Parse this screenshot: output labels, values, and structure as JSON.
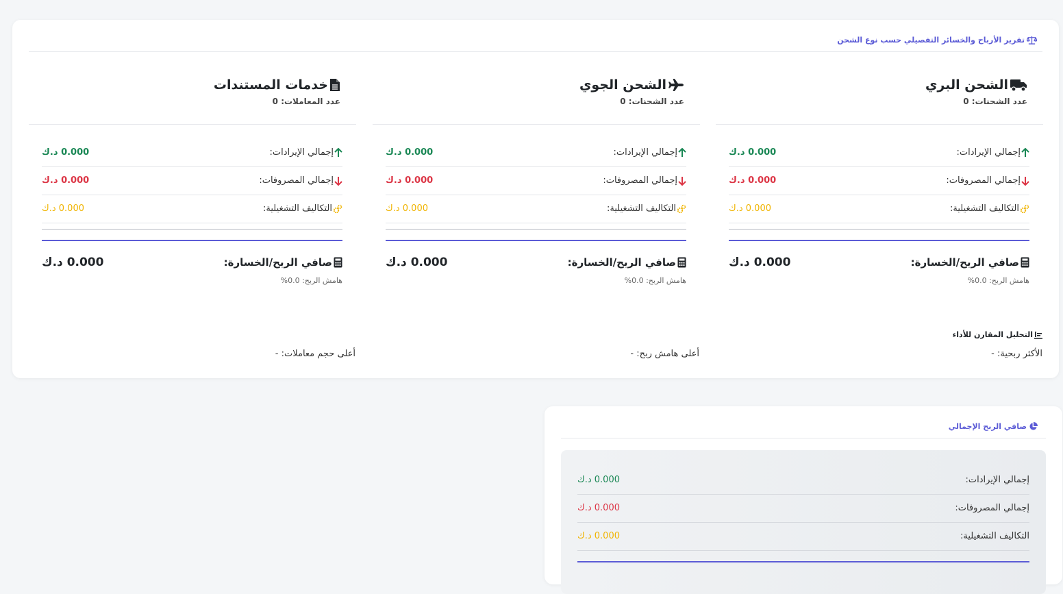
{
  "report": {
    "header_title": "تقرير الأرباح والخسائر التفصيلي حسب نوع الشحن",
    "columns": [
      {
        "title": "الشحن البري",
        "icon": "truck-icon",
        "count_label": "عدد الشحنات: 0",
        "revenue_label": "إجمالي الإيرادات:",
        "revenue_value": "0.000 د.ك",
        "expenses_label": "إجمالي المصروفات:",
        "expenses_value": "0.000 د.ك",
        "opcost_label": "التكاليف التشغيلية:",
        "opcost_value": "0.000 د.ك",
        "net_label": "صافي الربح/الخسارة:",
        "net_value": "0.000 د.ك",
        "margin_label": "هامش الربح: 0.0%"
      },
      {
        "title": "الشحن الجوي",
        "icon": "plane-icon",
        "count_label": "عدد الشحنات: 0",
        "revenue_label": "إجمالي الإيرادات:",
        "revenue_value": "0.000 د.ك",
        "expenses_label": "إجمالي المصروفات:",
        "expenses_value": "0.000 د.ك",
        "opcost_label": "التكاليف التشغيلية:",
        "opcost_value": "0.000 د.ك",
        "net_label": "صافي الربح/الخسارة:",
        "net_value": "0.000 د.ك",
        "margin_label": "هامش الربح: 0.0%"
      },
      {
        "title": "خدمات المستندات",
        "icon": "document-icon",
        "count_label": "عدد المعاملات: 0",
        "revenue_label": "إجمالي الإيرادات:",
        "revenue_value": "0.000 د.ك",
        "expenses_label": "إجمالي المصروفات:",
        "expenses_value": "0.000 د.ك",
        "opcost_label": "التكاليف التشغيلية:",
        "opcost_value": "0.000 د.ك",
        "net_label": "صافي الربح/الخسارة:",
        "net_value": "0.000 د.ك",
        "margin_label": "هامش الربح: 0.0%"
      }
    ],
    "comparison": {
      "title": "التحليل المقارن للأداء",
      "most_profitable": "الأكثر ربحية: -",
      "highest_margin": "أعلى هامش ربح: -",
      "highest_volume": "أعلى حجم معاملات: -"
    }
  },
  "summary": {
    "header_title": "صافي الربح الإجمالي",
    "revenue_label": "إجمالي الإيرادات:",
    "revenue_value": "0.000 د.ك",
    "expenses_label": "إجمالي المصروفات:",
    "expenses_value": "0.000 د.ك",
    "opcost_label": "التكاليف التشغيلية:",
    "opcost_value": "0.000 د.ك"
  },
  "colors": {
    "accent": "#5b5bd6",
    "green": "#198754",
    "red": "#dc3545",
    "yellow": "#f0b400"
  }
}
